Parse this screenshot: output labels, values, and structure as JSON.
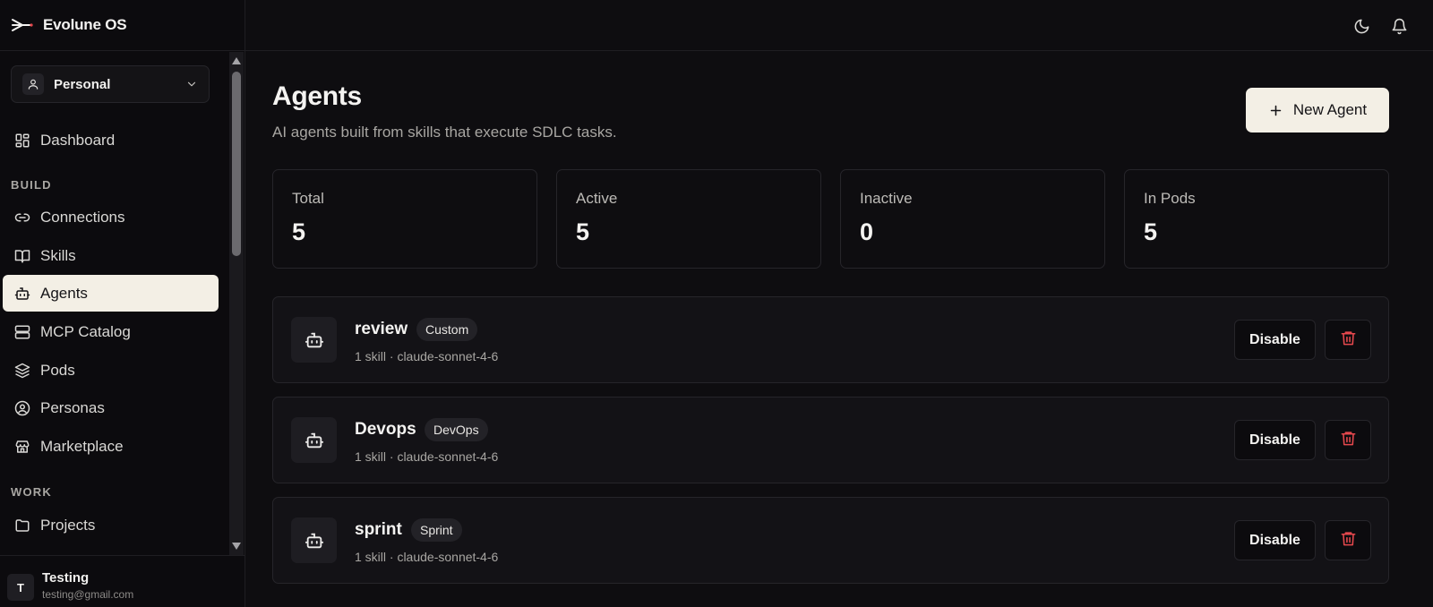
{
  "app": {
    "name": "Evolune OS"
  },
  "workspace": {
    "label": "Personal"
  },
  "sidebar": {
    "items": [
      {
        "label": "Dashboard"
      },
      {
        "label": "Connections"
      },
      {
        "label": "Skills"
      },
      {
        "label": "Agents",
        "active": true
      },
      {
        "label": "MCP Catalog"
      },
      {
        "label": "Pods"
      },
      {
        "label": "Personas"
      },
      {
        "label": "Marketplace"
      },
      {
        "label": "Projects"
      }
    ],
    "sections": {
      "build": "BUILD",
      "work": "WORK"
    }
  },
  "user": {
    "initial": "T",
    "name": "Testing",
    "email": "testing@gmail.com"
  },
  "page": {
    "title": "Agents",
    "subtitle": "AI agents built from skills that execute SDLC tasks.",
    "new_button": "New Agent"
  },
  "stats": [
    {
      "label": "Total",
      "value": "5"
    },
    {
      "label": "Active",
      "value": "5"
    },
    {
      "label": "Inactive",
      "value": "0"
    },
    {
      "label": "In Pods",
      "value": "5"
    }
  ],
  "agents": [
    {
      "name": "review",
      "tag": "Custom",
      "meta": "1 skill · claude-sonnet-4-6",
      "action": "Disable"
    },
    {
      "name": "Devops",
      "tag": "DevOps",
      "meta": "1 skill · claude-sonnet-4-6",
      "action": "Disable"
    },
    {
      "name": "sprint",
      "tag": "Sprint",
      "meta": "1 skill · claude-sonnet-4-6",
      "action": "Disable"
    }
  ],
  "colors": {
    "accent": "#f3efe5",
    "danger": "#e5484d",
    "background": "#0e0d10"
  },
  "icons": {
    "brand": "evolune-logo-icon",
    "topbar": [
      "moon-icon",
      "bell-icon"
    ],
    "agent": "bot-icon",
    "delete": "trash-icon"
  }
}
